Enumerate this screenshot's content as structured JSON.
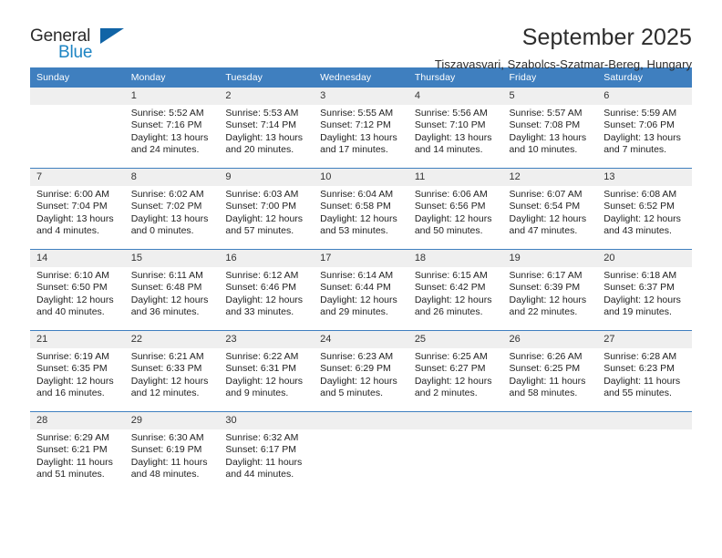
{
  "brand": {
    "name_part1": "General",
    "name_part2": "Blue",
    "triangle_color": "#1164a6",
    "blue_color": "#1d84c3"
  },
  "header": {
    "month_title": "September 2025",
    "location": "Tiszavasvari, Szabolcs-Szatmar-Bereg, Hungary"
  },
  "theme": {
    "header_bg": "#3f7fbf",
    "daynum_bg": "#efefef",
    "text": "#222222"
  },
  "calendar": {
    "weekday_headers": [
      "Sunday",
      "Monday",
      "Tuesday",
      "Wednesday",
      "Thursday",
      "Friday",
      "Saturday"
    ],
    "labels": {
      "sunrise": "Sunrise:",
      "sunset": "Sunset:",
      "daylight": "Daylight:"
    },
    "weeks": [
      [
        {
          "day": "",
          "blank": true,
          "sunrise": "",
          "sunset": "",
          "daylight_line1": "",
          "daylight_line2": ""
        },
        {
          "day": "1",
          "sunrise": "Sunrise: 5:52 AM",
          "sunset": "Sunset: 7:16 PM",
          "daylight_line1": "Daylight: 13 hours",
          "daylight_line2": "and 24 minutes."
        },
        {
          "day": "2",
          "sunrise": "Sunrise: 5:53 AM",
          "sunset": "Sunset: 7:14 PM",
          "daylight_line1": "Daylight: 13 hours",
          "daylight_line2": "and 20 minutes."
        },
        {
          "day": "3",
          "sunrise": "Sunrise: 5:55 AM",
          "sunset": "Sunset: 7:12 PM",
          "daylight_line1": "Daylight: 13 hours",
          "daylight_line2": "and 17 minutes."
        },
        {
          "day": "4",
          "sunrise": "Sunrise: 5:56 AM",
          "sunset": "Sunset: 7:10 PM",
          "daylight_line1": "Daylight: 13 hours",
          "daylight_line2": "and 14 minutes."
        },
        {
          "day": "5",
          "sunrise": "Sunrise: 5:57 AM",
          "sunset": "Sunset: 7:08 PM",
          "daylight_line1": "Daylight: 13 hours",
          "daylight_line2": "and 10 minutes."
        },
        {
          "day": "6",
          "sunrise": "Sunrise: 5:59 AM",
          "sunset": "Sunset: 7:06 PM",
          "daylight_line1": "Daylight: 13 hours",
          "daylight_line2": "and 7 minutes."
        }
      ],
      [
        {
          "day": "7",
          "sunrise": "Sunrise: 6:00 AM",
          "sunset": "Sunset: 7:04 PM",
          "daylight_line1": "Daylight: 13 hours",
          "daylight_line2": "and 4 minutes."
        },
        {
          "day": "8",
          "sunrise": "Sunrise: 6:02 AM",
          "sunset": "Sunset: 7:02 PM",
          "daylight_line1": "Daylight: 13 hours",
          "daylight_line2": "and 0 minutes."
        },
        {
          "day": "9",
          "sunrise": "Sunrise: 6:03 AM",
          "sunset": "Sunset: 7:00 PM",
          "daylight_line1": "Daylight: 12 hours",
          "daylight_line2": "and 57 minutes."
        },
        {
          "day": "10",
          "sunrise": "Sunrise: 6:04 AM",
          "sunset": "Sunset: 6:58 PM",
          "daylight_line1": "Daylight: 12 hours",
          "daylight_line2": "and 53 minutes."
        },
        {
          "day": "11",
          "sunrise": "Sunrise: 6:06 AM",
          "sunset": "Sunset: 6:56 PM",
          "daylight_line1": "Daylight: 12 hours",
          "daylight_line2": "and 50 minutes."
        },
        {
          "day": "12",
          "sunrise": "Sunrise: 6:07 AM",
          "sunset": "Sunset: 6:54 PM",
          "daylight_line1": "Daylight: 12 hours",
          "daylight_line2": "and 47 minutes."
        },
        {
          "day": "13",
          "sunrise": "Sunrise: 6:08 AM",
          "sunset": "Sunset: 6:52 PM",
          "daylight_line1": "Daylight: 12 hours",
          "daylight_line2": "and 43 minutes."
        }
      ],
      [
        {
          "day": "14",
          "sunrise": "Sunrise: 6:10 AM",
          "sunset": "Sunset: 6:50 PM",
          "daylight_line1": "Daylight: 12 hours",
          "daylight_line2": "and 40 minutes."
        },
        {
          "day": "15",
          "sunrise": "Sunrise: 6:11 AM",
          "sunset": "Sunset: 6:48 PM",
          "daylight_line1": "Daylight: 12 hours",
          "daylight_line2": "and 36 minutes."
        },
        {
          "day": "16",
          "sunrise": "Sunrise: 6:12 AM",
          "sunset": "Sunset: 6:46 PM",
          "daylight_line1": "Daylight: 12 hours",
          "daylight_line2": "and 33 minutes."
        },
        {
          "day": "17",
          "sunrise": "Sunrise: 6:14 AM",
          "sunset": "Sunset: 6:44 PM",
          "daylight_line1": "Daylight: 12 hours",
          "daylight_line2": "and 29 minutes."
        },
        {
          "day": "18",
          "sunrise": "Sunrise: 6:15 AM",
          "sunset": "Sunset: 6:42 PM",
          "daylight_line1": "Daylight: 12 hours",
          "daylight_line2": "and 26 minutes."
        },
        {
          "day": "19",
          "sunrise": "Sunrise: 6:17 AM",
          "sunset": "Sunset: 6:39 PM",
          "daylight_line1": "Daylight: 12 hours",
          "daylight_line2": "and 22 minutes."
        },
        {
          "day": "20",
          "sunrise": "Sunrise: 6:18 AM",
          "sunset": "Sunset: 6:37 PM",
          "daylight_line1": "Daylight: 12 hours",
          "daylight_line2": "and 19 minutes."
        }
      ],
      [
        {
          "day": "21",
          "sunrise": "Sunrise: 6:19 AM",
          "sunset": "Sunset: 6:35 PM",
          "daylight_line1": "Daylight: 12 hours",
          "daylight_line2": "and 16 minutes."
        },
        {
          "day": "22",
          "sunrise": "Sunrise: 6:21 AM",
          "sunset": "Sunset: 6:33 PM",
          "daylight_line1": "Daylight: 12 hours",
          "daylight_line2": "and 12 minutes."
        },
        {
          "day": "23",
          "sunrise": "Sunrise: 6:22 AM",
          "sunset": "Sunset: 6:31 PM",
          "daylight_line1": "Daylight: 12 hours",
          "daylight_line2": "and 9 minutes."
        },
        {
          "day": "24",
          "sunrise": "Sunrise: 6:23 AM",
          "sunset": "Sunset: 6:29 PM",
          "daylight_line1": "Daylight: 12 hours",
          "daylight_line2": "and 5 minutes."
        },
        {
          "day": "25",
          "sunrise": "Sunrise: 6:25 AM",
          "sunset": "Sunset: 6:27 PM",
          "daylight_line1": "Daylight: 12 hours",
          "daylight_line2": "and 2 minutes."
        },
        {
          "day": "26",
          "sunrise": "Sunrise: 6:26 AM",
          "sunset": "Sunset: 6:25 PM",
          "daylight_line1": "Daylight: 11 hours",
          "daylight_line2": "and 58 minutes."
        },
        {
          "day": "27",
          "sunrise": "Sunrise: 6:28 AM",
          "sunset": "Sunset: 6:23 PM",
          "daylight_line1": "Daylight: 11 hours",
          "daylight_line2": "and 55 minutes."
        }
      ],
      [
        {
          "day": "28",
          "sunrise": "Sunrise: 6:29 AM",
          "sunset": "Sunset: 6:21 PM",
          "daylight_line1": "Daylight: 11 hours",
          "daylight_line2": "and 51 minutes."
        },
        {
          "day": "29",
          "sunrise": "Sunrise: 6:30 AM",
          "sunset": "Sunset: 6:19 PM",
          "daylight_line1": "Daylight: 11 hours",
          "daylight_line2": "and 48 minutes."
        },
        {
          "day": "30",
          "sunrise": "Sunrise: 6:32 AM",
          "sunset": "Sunset: 6:17 PM",
          "daylight_line1": "Daylight: 11 hours",
          "daylight_line2": "and 44 minutes."
        },
        {
          "day": "",
          "blank": true,
          "sunrise": "",
          "sunset": "",
          "daylight_line1": "",
          "daylight_line2": ""
        },
        {
          "day": "",
          "blank": true,
          "sunrise": "",
          "sunset": "",
          "daylight_line1": "",
          "daylight_line2": ""
        },
        {
          "day": "",
          "blank": true,
          "sunrise": "",
          "sunset": "",
          "daylight_line1": "",
          "daylight_line2": ""
        },
        {
          "day": "",
          "blank": true,
          "sunrise": "",
          "sunset": "",
          "daylight_line1": "",
          "daylight_line2": ""
        }
      ]
    ]
  }
}
